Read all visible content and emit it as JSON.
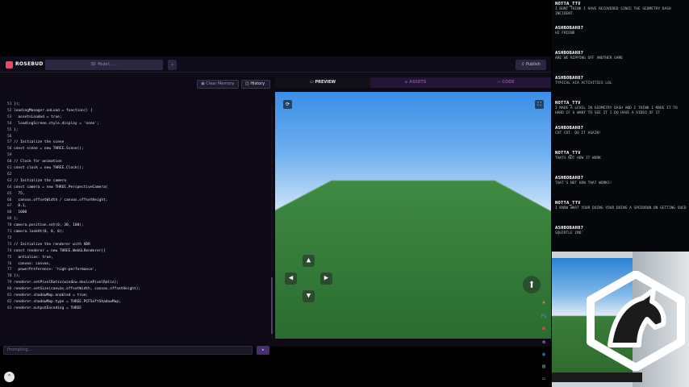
{
  "app": {
    "brand": "ROSEBUD AI",
    "prompt_placeholder": "3D Model...",
    "chevron_icon": "chevron-left-icon",
    "publish_label": "Publish",
    "clear_memory_label": "Clear Memory",
    "history_label": "History",
    "chat_placeholder": "Prompting...",
    "accent": "#e24a6a"
  },
  "tabs": [
    {
      "label": "PREVIEW",
      "icon": "monitor-icon"
    },
    {
      "label": "ASSETS",
      "icon": "assets-icon"
    },
    {
      "label": "CODE",
      "icon": "code-icon"
    }
  ],
  "code_lines": [
    {
      "n": "51",
      "t": "});"
    },
    {
      "n": "52",
      "t": "loadingManager.onLoad = function() {"
    },
    {
      "n": "53",
      "t": "  assetsLoaded = true;"
    },
    {
      "n": "54",
      "t": "  loadingScreen.style.display = 'none';"
    },
    {
      "n": "55",
      "t": "};"
    },
    {
      "n": "56",
      "t": ""
    },
    {
      "n": "57",
      "t": "// Initialize the scene"
    },
    {
      "n": "58",
      "t": "const scene = new THREE.Scene();"
    },
    {
      "n": "59",
      "t": ""
    },
    {
      "n": "60",
      "t": "// Clock for animation"
    },
    {
      "n": "61",
      "t": "const clock = new THREE.Clock();"
    },
    {
      "n": "62",
      "t": ""
    },
    {
      "n": "63",
      "t": "// Initialize the camera"
    },
    {
      "n": "64",
      "t": "const camera = new THREE.PerspectiveCamera("
    },
    {
      "n": "65",
      "t": "  75,"
    },
    {
      "n": "66",
      "t": "  canvas.offsetWidth / canvas.offsetHeight,"
    },
    {
      "n": "67",
      "t": "  0.1,"
    },
    {
      "n": "68",
      "t": "  1000"
    },
    {
      "n": "69",
      "t": ");"
    },
    {
      "n": "70",
      "t": "camera.position.set(0, 30, 100);"
    },
    {
      "n": "71",
      "t": "camera.lookAt(0, 0, 0);"
    },
    {
      "n": "72",
      "t": ""
    },
    {
      "n": "73",
      "t": "// Initialize the renderer with HDR"
    },
    {
      "n": "74",
      "t": "const renderer = new THREE.WebGLRenderer({"
    },
    {
      "n": "75",
      "t": "  antialias: true,"
    },
    {
      "n": "76",
      "t": "  canvas: canvas,"
    },
    {
      "n": "77",
      "t": "  powerPreference: 'high-performance',"
    },
    {
      "n": "78",
      "t": "});"
    },
    {
      "n": "79",
      "t": "renderer.setPixelRatio(window.devicePixelRatio);"
    },
    {
      "n": "80",
      "t": "renderer.setSize(canvas.offsetWidth, canvas.offsetHeight);"
    },
    {
      "n": "81",
      "t": "renderer.shadowMap.enabled = true;"
    },
    {
      "n": "82",
      "t": "renderer.shadowMap.type = THREE.PCFSoftShadowMap;"
    },
    {
      "n": "83",
      "t": "renderer.outputEncoding = THREE"
    }
  ],
  "viewport": {
    "sky_top": "#3b8ee8",
    "ground_color": "#2f7a35",
    "refresh_icon": "refresh-icon",
    "fullscreen_icon": "fullscreen-icon",
    "up_icon": "arrow-up-icon",
    "down_icon": "arrow-down-icon",
    "left_icon": "arrow-left-icon",
    "right_icon": "arrow-right-icon",
    "jump_icon": "jump-arrow-icon"
  },
  "chat": [
    {
      "user": "NOTTA_TTV",
      "text": "I DONT THINK I HAVE RECOVERED SINCE THE GEOMETRY DASH INCIDENT"
    },
    {
      "user": "ASHBOBAH87",
      "text": "HI FRIEND"
    },
    {
      "user": "ASHBOBAH87",
      "text": "ARE WE RIPPING OFF ANOTHER GAME"
    },
    {
      "user": "ASHBOBAH87",
      "text": "TYPICAL AIA ACTIVITIES LOL"
    },
    {
      "user": "NOTTA_TTV",
      "text": "I MADE A LEVEL IN GEOMETRY DASH AND I THINK I MADE IT TO HARD IF U WANT TO SEE IT I DO HAVE A VIDEO OF IT"
    },
    {
      "user": "ASHBOBAH87",
      "text": "CUT CUT. DO IT AGAIN!"
    },
    {
      "user": "NOTTA_TTV",
      "text": "THATS NOT HOW IT WORK"
    },
    {
      "user": "ASHBOBAH87",
      "text": "THAT'S NOT HOW THAT WORKS!"
    },
    {
      "user": "NOTTA_TTV",
      "text": "I KNOW WHAT YOUR DOING YOUR DOING A SPEEDRUN ON GETTING SUED"
    },
    {
      "user": "ASHBOBAH87",
      "text": "SQUIRTLE IMO"
    }
  ]
}
